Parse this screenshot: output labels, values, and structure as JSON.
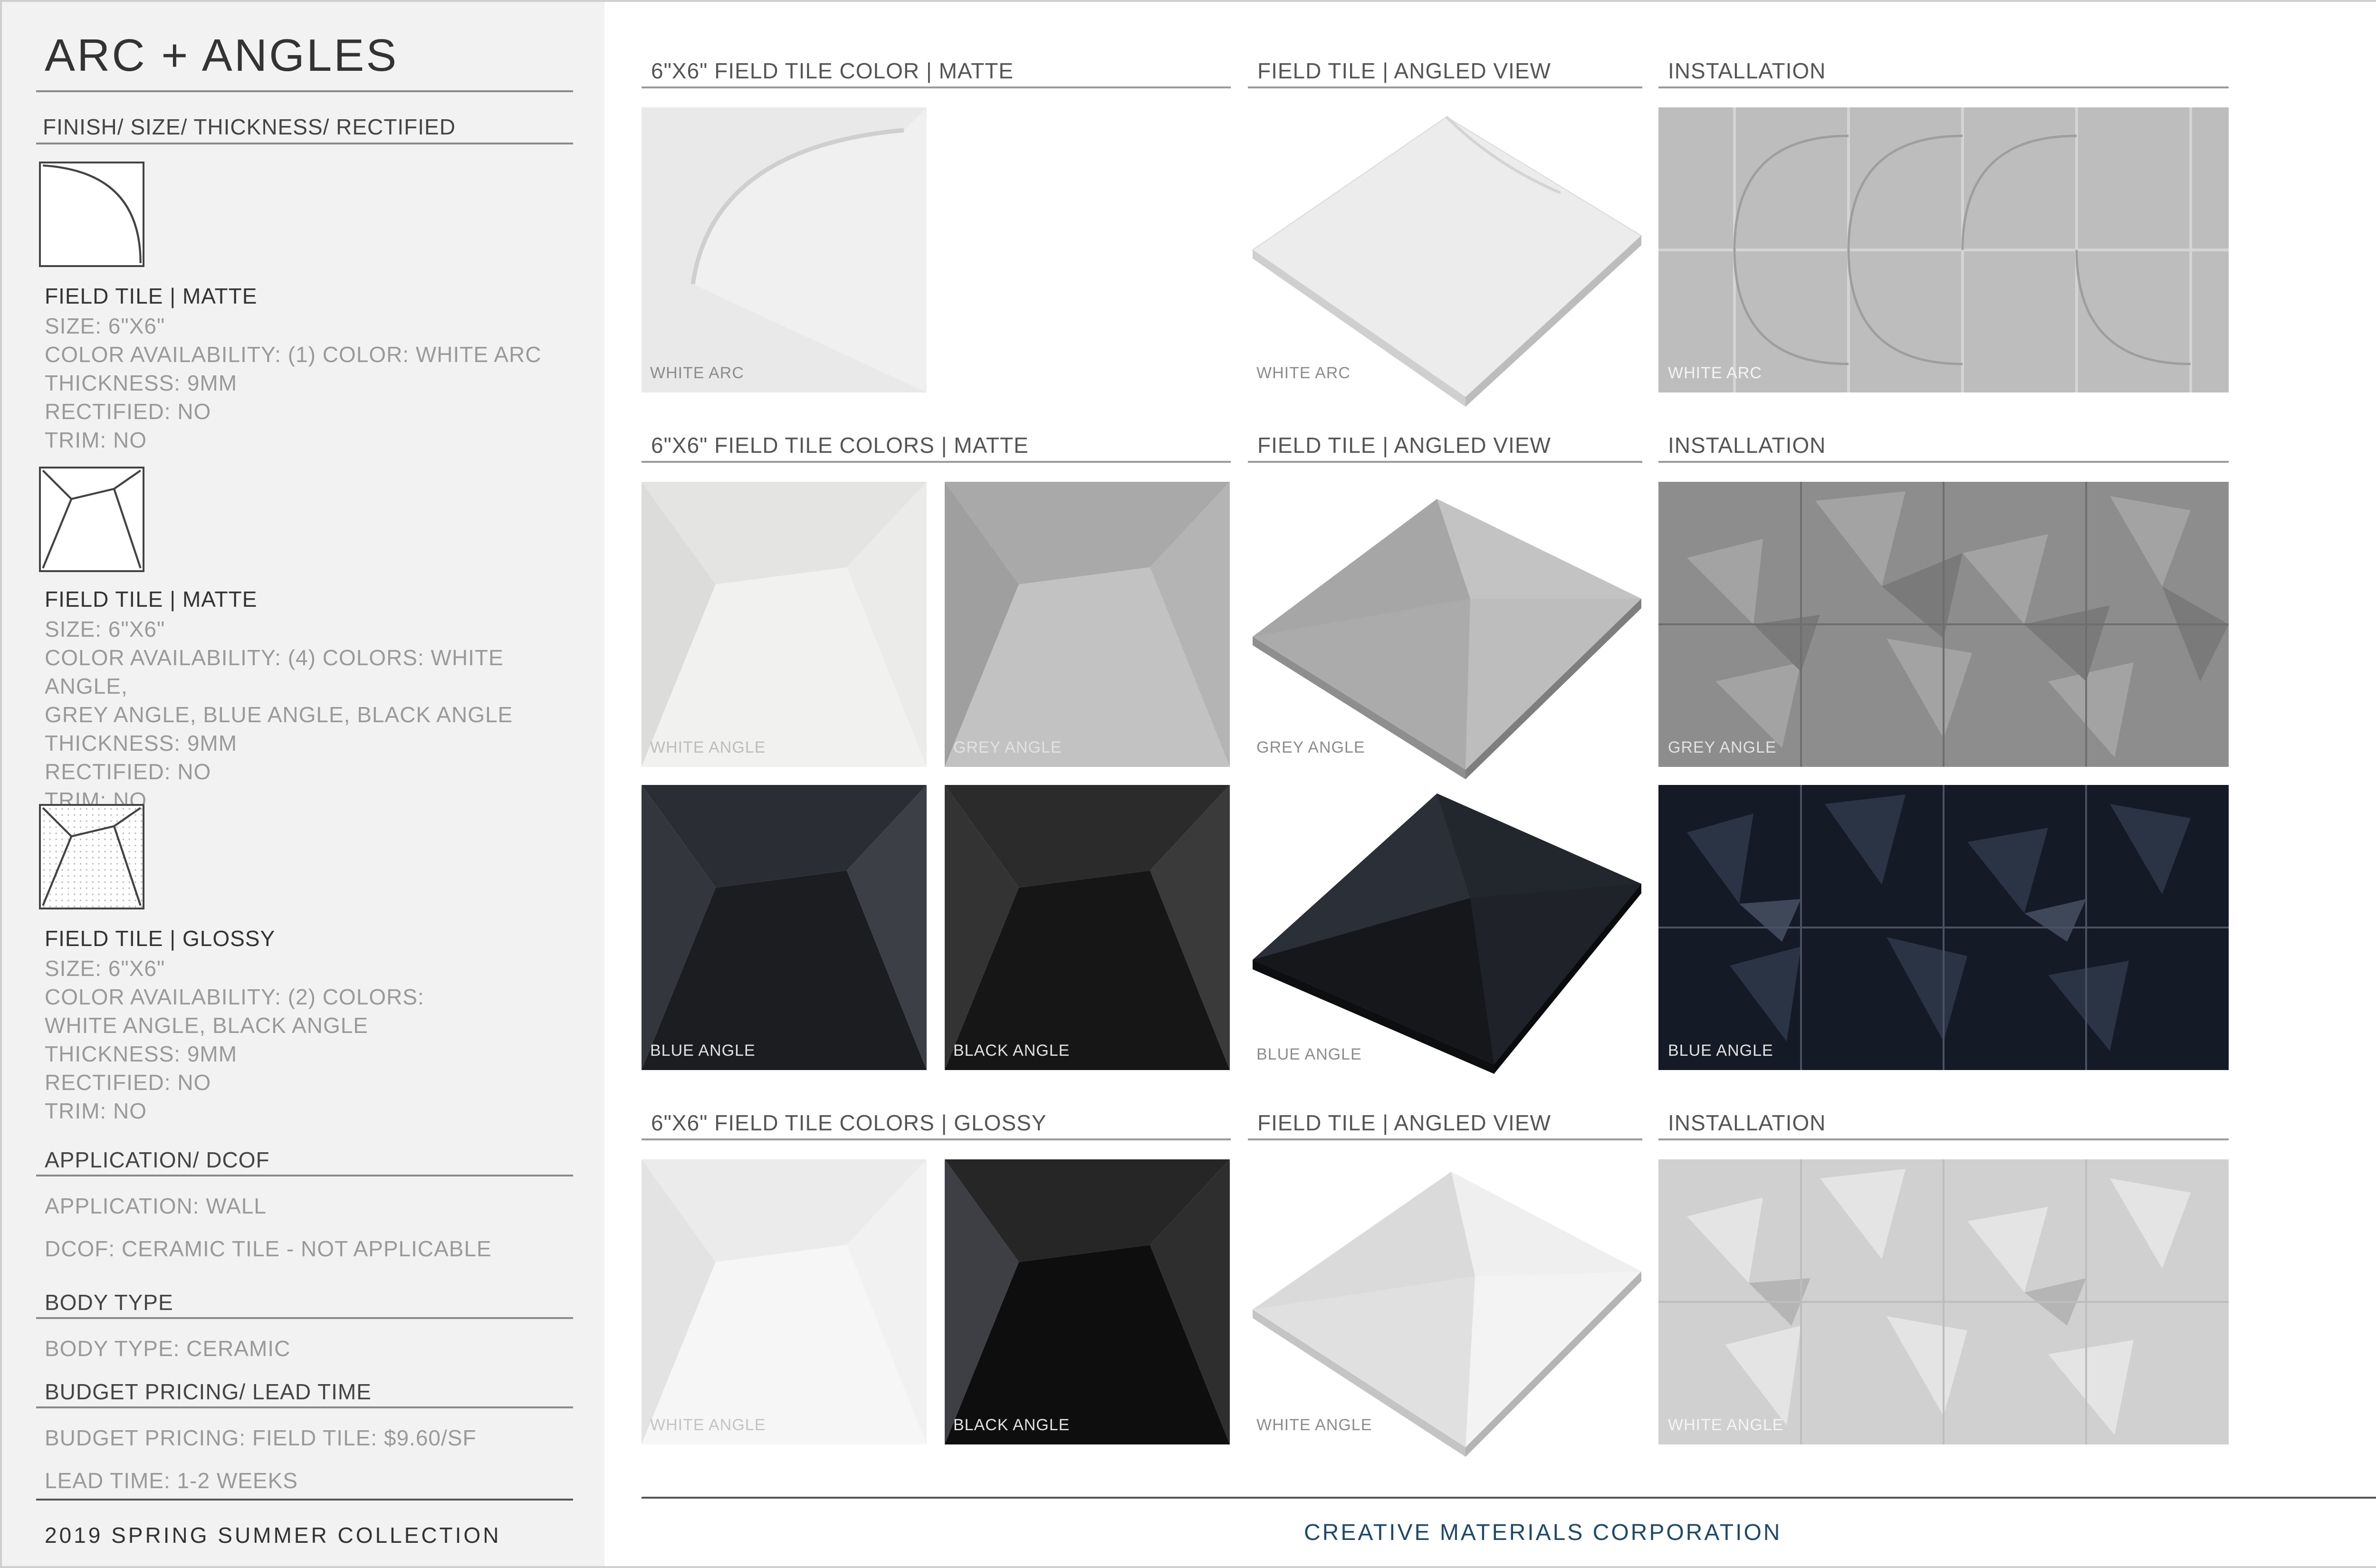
{
  "sidebar": {
    "title": "ARC + ANGLES",
    "finish_heading": "FINISH/ SIZE/ THICKNESS/ RECTIFIED",
    "items": [
      {
        "title": "FIELD TILE | MATTE",
        "lines": [
          "SIZE: 6\"X6\"",
          "COLOR AVAILABILITY: (1) COLOR: WHITE ARC",
          "THICKNESS: 9MM",
          "RECTIFIED: NO",
          "TRIM: NO"
        ],
        "diagram_icon": "arc-tile-diagram-icon"
      },
      {
        "title": "FIELD TILE | MATTE",
        "lines": [
          "SIZE: 6\"X6\"",
          "COLOR AVAILABILITY: (4) COLORS: WHITE ANGLE,",
          "GREY ANGLE, BLUE ANGLE, BLACK ANGLE",
          "THICKNESS: 9MM",
          "RECTIFIED: NO",
          "TRIM: NO"
        ],
        "diagram_icon": "angle-tile-diagram-icon"
      },
      {
        "title": "FIELD TILE | GLOSSY",
        "lines": [
          "SIZE: 6\"X6\"",
          "COLOR AVAILABILITY: (2) COLORS:",
          "WHITE ANGLE, BLACK ANGLE",
          "THICKNESS: 9MM",
          "RECTIFIED: NO",
          "TRIM: NO"
        ],
        "diagram_icon": "angle-tile-glossy-diagram-icon"
      }
    ],
    "application_heading": "APPLICATION/ DCOF",
    "application": "APPLICATION: WALL",
    "dcof": "DCOF: CERAMIC TILE - NOT APPLICABLE",
    "body_heading": "BODY TYPE",
    "body_type": "BODY TYPE: CERAMIC",
    "pricing_heading": "BUDGET PRICING/ LEAD TIME",
    "pricing": "BUDGET PRICING: FIELD TILE: $9.60/SF",
    "lead_time": "LEAD TIME: 1-2 WEEKS",
    "collection": "2019 SPRING SUMMER COLLECTION"
  },
  "rows": [
    {
      "heading_tiles": "6\"X6\" FIELD TILE COLOR | MATTE",
      "heading_angled": "FIELD TILE | ANGLED VIEW",
      "heading_install": "INSTALLATION",
      "swatches": [
        "WHITE ARC"
      ],
      "angled_caption": "WHITE ARC",
      "install_caption": "WHITE ARC"
    },
    {
      "heading_tiles": "6\"X6\" FIELD TILE COLORS | MATTE",
      "heading_angled": "FIELD TILE | ANGLED VIEW",
      "heading_install": "INSTALLATION",
      "swatches": [
        "WHITE ANGLE",
        "GREY ANGLE",
        "BLUE ANGLE",
        "BLACK ANGLE"
      ],
      "angled_captions": [
        "GREY ANGLE",
        "BLUE ANGLE"
      ],
      "install_captions": [
        "GREY ANGLE",
        "BLUE ANGLE"
      ]
    },
    {
      "heading_tiles": "6\"X6\" FIELD TILE COLORS | GLOSSY",
      "heading_angled": "FIELD TILE | ANGLED VIEW",
      "heading_install": "INSTALLATION",
      "swatches": [
        "WHITE ANGLE",
        "BLACK ANGLE"
      ],
      "angled_caption": "WHITE ANGLE",
      "install_caption": "WHITE ANGLE"
    }
  ],
  "footer": {
    "company": "CREATIVE MATERIALS CORPORATION"
  },
  "colors": {
    "sidebar_bg": "#f2f2f2",
    "company_text": "#1e4a6b",
    "rule": "#8a8a8a"
  }
}
